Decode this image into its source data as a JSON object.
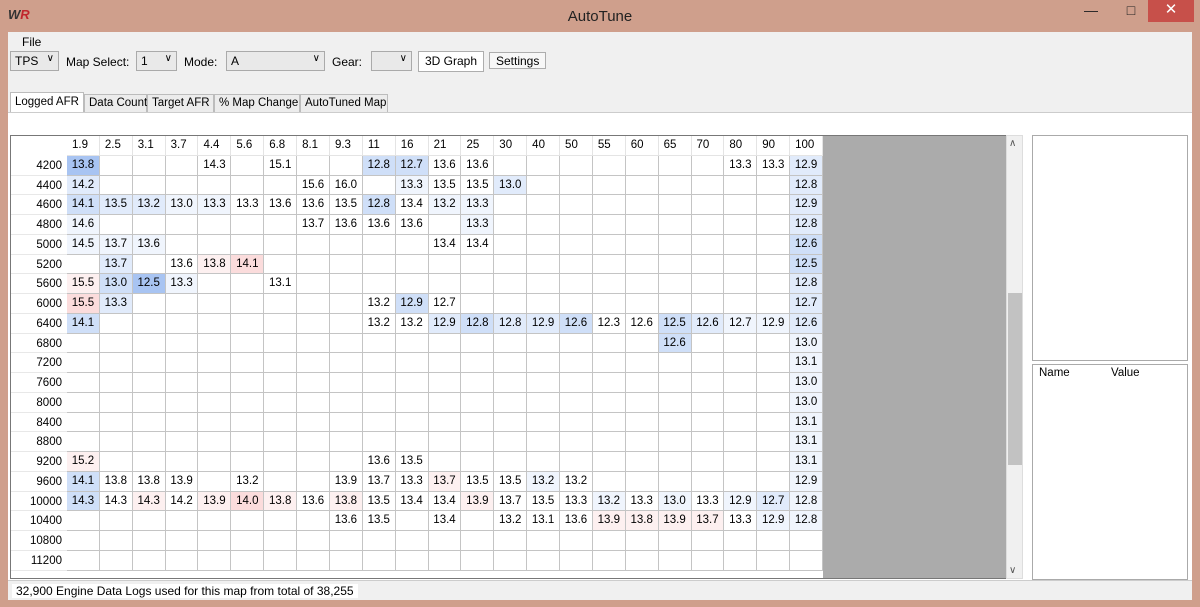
{
  "window": {
    "title": "AutoTune",
    "logo": "WR",
    "minimize_icon": "minimize-icon",
    "maximize_icon": "maximize-icon",
    "close_icon": "close-icon"
  },
  "menu": {
    "file": "File"
  },
  "toolbar": {
    "axis_select": "TPS",
    "map_select_label": "Map Select:",
    "map_select": "1",
    "mode_label": "Mode:",
    "mode": "A",
    "gear_label": "Gear:",
    "gear": "",
    "graph_button": "3D Graph",
    "settings_button": "Settings"
  },
  "tabs": [
    {
      "label": "Logged AFR",
      "active": true
    },
    {
      "label": "Data Count"
    },
    {
      "label": "Target AFR"
    },
    {
      "label": "% Map Change"
    },
    {
      "label": "AutoTuned Map"
    }
  ],
  "table": {
    "columns": [
      "1.9",
      "2.5",
      "3.1",
      "3.7",
      "4.4",
      "5.6",
      "6.8",
      "8.1",
      "9.3",
      "11",
      "16",
      "21",
      "25",
      "30",
      "40",
      "50",
      "55",
      "60",
      "65",
      "70",
      "80",
      "90",
      "100"
    ],
    "rows": [
      {
        "rpm": "4200",
        "cells": [
          "13.8:b3",
          "",
          "",
          "",
          "14.3",
          "",
          "15.1",
          "",
          "",
          "12.8:b2",
          "12.7:b2",
          "13.6",
          "13.6",
          "",
          "",
          "",
          "",
          "",
          "",
          "",
          "13.3",
          "13.3",
          "12.9:b1"
        ]
      },
      {
        "rpm": "4400",
        "cells": [
          "14.2:b1",
          "",
          "",
          "",
          "",
          "",
          "",
          "15.6",
          "16.0",
          "",
          "13.3:b0",
          "13.5",
          "13.5",
          "13.0:b1",
          "",
          "",
          "",
          "",
          "",
          "",
          "",
          "",
          "12.8:b1"
        ]
      },
      {
        "rpm": "4600",
        "cells": [
          "14.1:b2",
          "13.5:b1",
          "13.2:b1",
          "13.0:b0",
          "13.3:b0",
          "13.3",
          "13.6",
          "13.6",
          "13.5",
          "12.8:b2",
          "13.4",
          "13.2:b0",
          "13.3:b0",
          "",
          "",
          "",
          "",
          "",
          "",
          "",
          "",
          "",
          "12.9:b1"
        ]
      },
      {
        "rpm": "4800",
        "cells": [
          "14.6:b0",
          "",
          "",
          "",
          "",
          "",
          "",
          "13.7",
          "13.6",
          "13.6",
          "13.6",
          "",
          "13.3:b0",
          "",
          "",
          "",
          "",
          "",
          "",
          "",
          "",
          "",
          "12.8:b1"
        ]
      },
      {
        "rpm": "5000",
        "cells": [
          "14.5:b0",
          "13.7:b0",
          "13.6:b0",
          "",
          "",
          "",
          "",
          "",
          "",
          "",
          "",
          "13.4",
          "13.4",
          "",
          "",
          "",
          "",
          "",
          "",
          "",
          "",
          "",
          "12.6:b2"
        ]
      },
      {
        "rpm": "5200",
        "cells": [
          "",
          "13.7:b1",
          "",
          "13.6",
          "13.8:r1",
          "14.1:r2",
          "",
          "",
          "",
          "",
          "",
          "",
          "",
          "",
          "",
          "",
          "",
          "",
          "",
          "",
          "",
          "",
          "12.5:b2"
        ]
      },
      {
        "rpm": "5600",
        "cells": [
          "15.5:r1",
          "13.0:b2",
          "12.5:b3",
          "13.3:b0",
          "",
          "",
          "13.1",
          "",
          "",
          "",
          "",
          "",
          "",
          "",
          "",
          "",
          "",
          "",
          "",
          "",
          "",
          "",
          "12.8:b1"
        ]
      },
      {
        "rpm": "6000",
        "cells": [
          "15.5:r2",
          "13.3:b1",
          "",
          "",
          "",
          "",
          "",
          "",
          "",
          "13.2",
          "12.9:b2",
          "12.7",
          "",
          "",
          "",
          "",
          "",
          "",
          "",
          "",
          "",
          "",
          "12.7:b1"
        ]
      },
      {
        "rpm": "6400",
        "cells": [
          "14.1:b2",
          "",
          "",
          "",
          "",
          "",
          "",
          "",
          "",
          "13.2",
          "13.2",
          "12.9:b1",
          "12.8:b2",
          "12.8:b1",
          "12.9:b1",
          "12.6:b2",
          "12.3",
          "12.6",
          "12.5:b2",
          "12.6:b1",
          "12.7:b0",
          "12.9:b0",
          "12.6:b1"
        ]
      },
      {
        "rpm": "6800",
        "cells": [
          "",
          "",
          "",
          "",
          "",
          "",
          "",
          "",
          "",
          "",
          "",
          "",
          "",
          "",
          "",
          "",
          "",
          "",
          "12.6:b2",
          "",
          "",
          "",
          "13.0:b0"
        ]
      },
      {
        "rpm": "7200",
        "cells": [
          "",
          "",
          "",
          "",
          "",
          "",
          "",
          "",
          "",
          "",
          "",
          "",
          "",
          "",
          "",
          "",
          "",
          "",
          "",
          "",
          "",
          "",
          "13.1:b0"
        ]
      },
      {
        "rpm": "7600",
        "cells": [
          "",
          "",
          "",
          "",
          "",
          "",
          "",
          "",
          "",
          "",
          "",
          "",
          "",
          "",
          "",
          "",
          "",
          "",
          "",
          "",
          "",
          "",
          "13.0:b0"
        ]
      },
      {
        "rpm": "8000",
        "cells": [
          "",
          "",
          "",
          "",
          "",
          "",
          "",
          "",
          "",
          "",
          "",
          "",
          "",
          "",
          "",
          "",
          "",
          "",
          "",
          "",
          "",
          "",
          "13.0:b0"
        ]
      },
      {
        "rpm": "8400",
        "cells": [
          "",
          "",
          "",
          "",
          "",
          "",
          "",
          "",
          "",
          "",
          "",
          "",
          "",
          "",
          "",
          "",
          "",
          "",
          "",
          "",
          "",
          "",
          "13.1:b0"
        ]
      },
      {
        "rpm": "8800",
        "cells": [
          "",
          "",
          "",
          "",
          "",
          "",
          "",
          "",
          "",
          "",
          "",
          "",
          "",
          "",
          "",
          "",
          "",
          "",
          "",
          "",
          "",
          "",
          "13.1:b0"
        ]
      },
      {
        "rpm": "9200",
        "cells": [
          "15.2:r1",
          "",
          "",
          "",
          "",
          "",
          "",
          "",
          "",
          "13.6",
          "13.5",
          "",
          "",
          "",
          "",
          "",
          "",
          "",
          "",
          "",
          "",
          "",
          "13.1:b0"
        ]
      },
      {
        "rpm": "9600",
        "cells": [
          "14.1:b2",
          "13.8",
          "13.8",
          "13.9",
          "",
          "13.2",
          "",
          "",
          "13.9",
          "13.7",
          "13.3",
          "13.7:r1",
          "13.5",
          "13.5",
          "13.2:b0",
          "13.2",
          "",
          "",
          "",
          "",
          "",
          "",
          "12.9:b0"
        ]
      },
      {
        "rpm": "10000",
        "cells": [
          "14.3:b2",
          "14.3",
          "14.3:r1",
          "14.2",
          "13.9:r1",
          "14.0:r2",
          "13.8:r1",
          "13.6",
          "13.8:r1",
          "13.5",
          "13.4",
          "13.4",
          "13.9:r1",
          "13.7",
          "13.5",
          "13.3",
          "13.2:b0",
          "13.3",
          "13.0:b0",
          "13.3",
          "12.9:b0",
          "12.7:b1",
          "12.8:b0"
        ]
      },
      {
        "rpm": "10400",
        "cells": [
          "",
          "",
          "",
          "",
          "",
          "",
          "",
          "",
          "13.6",
          "13.5",
          "",
          "13.4",
          "",
          "13.2",
          "13.1",
          "13.6",
          "13.9:r1",
          "13.8:r1",
          "13.9:r1",
          "13.7:r1",
          "13.3",
          "12.9:b0",
          "12.8:b0"
        ]
      },
      {
        "rpm": "10800",
        "cells": [
          "",
          "",
          "",
          "",
          "",
          "",
          "",
          "",
          "",
          "",
          "",
          "",
          "",
          "",
          "",
          "",
          "",
          "",
          "",
          "",
          "",
          "",
          ""
        ]
      },
      {
        "rpm": "11200",
        "cells": [
          "",
          "",
          "",
          "",
          "",
          "",
          "",
          "",
          "",
          "",
          "",
          "",
          "",
          "",
          "",
          "",
          "",
          "",
          "",
          "",
          "",
          "",
          ""
        ]
      }
    ]
  },
  "properties": {
    "name_header": "Name",
    "value_header": "Value"
  },
  "status": "32,900 Engine Data Logs used for this map from total of 38,255",
  "colors": {
    "titlebar": "#cf9f8c",
    "lean_shade": "#fbdcdc",
    "rich_shade": "#a8c4f2"
  }
}
